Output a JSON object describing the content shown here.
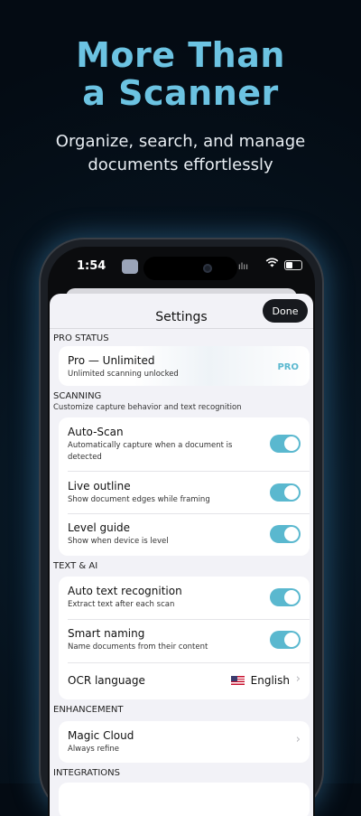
{
  "hero": {
    "title_line1": "More Than",
    "title_line2": "a Scanner",
    "subtitle_line1": "Organize, search, and manage",
    "subtitle_line2": "documents effortlessly"
  },
  "status_bar": {
    "time": "1:54",
    "battery_level": 0.45
  },
  "settings": {
    "title": "Settings",
    "done_label": "Done",
    "sections": {
      "pro": {
        "header": "PRO STATUS",
        "title": "Pro — Unlimited",
        "subtitle": "Unlimited scanning unlocked",
        "badge": "PRO"
      },
      "scanning": {
        "header": "SCANNING",
        "subheader": "Customize capture behavior and text recognition",
        "rows": [
          {
            "title": "Auto-Scan",
            "subtitle_line1": "Automatically capture when a document is",
            "subtitle_line2": "detected",
            "enabled": true
          },
          {
            "title": "Live outline",
            "subtitle": "Show document edges while framing",
            "enabled": true
          },
          {
            "title": "Level guide",
            "subtitle": "Show when device is level",
            "enabled": true
          }
        ]
      },
      "text_ai": {
        "header": "TEXT & AI",
        "rows": [
          {
            "title": "Auto text recognition",
            "subtitle": "Extract text after each scan",
            "enabled": true
          },
          {
            "title": "Smart naming",
            "subtitle": "Name documents from their content",
            "enabled": true
          },
          {
            "title": "OCR language",
            "value": "English"
          }
        ]
      },
      "enhancement": {
        "header": "ENHANCEMENT",
        "title": "Magic Cloud",
        "subtitle": "Always refine"
      },
      "integrations": {
        "header": "INTEGRATIONS"
      }
    }
  },
  "colors": {
    "accent": "#5ab8cf",
    "headline": "#6cc3e2",
    "background": "#06121d"
  },
  "icons": {
    "wifi": "wifi-icon",
    "battery": "battery-icon",
    "chevron": "chevron-right-icon",
    "flag": "us-flag-icon",
    "audio": "audio-wave-icon"
  }
}
